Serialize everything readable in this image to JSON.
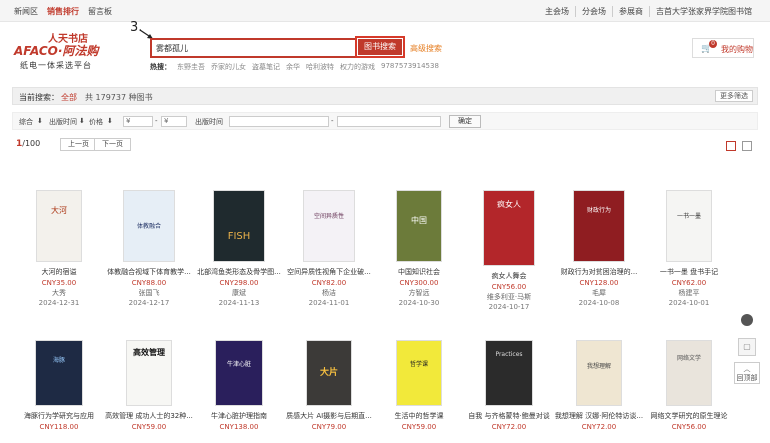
{
  "topnav": {
    "left": [
      "新闻区",
      "销售排行",
      "留言板"
    ],
    "right": [
      "主会场",
      "分会场",
      "参展商",
      "吉首大学张家界学院图书馆"
    ]
  },
  "logo": {
    "line1": "人天书店",
    "line2": "AFACO·阿法购",
    "line3": "纸电一体采选平台"
  },
  "step_marker": "3.",
  "search": {
    "value": "雾都孤儿",
    "button": "图书搜索",
    "advanced": "高级搜索"
  },
  "hot": {
    "label": "热搜：",
    "keywords": [
      "东野圭吾",
      "乔家的儿女",
      "盗墓笔记",
      "余华",
      "哈利波特",
      "权力的游戏",
      "9787573914538"
    ]
  },
  "cart": {
    "count": "0",
    "label": "我的购物"
  },
  "filter": {
    "current": "当前搜索：",
    "all": "全部",
    "total": "共 179737 种图书",
    "more": "更多筛选"
  },
  "sort": {
    "composite": "综合",
    "pubtime": "出版时间",
    "price": "价格",
    "currency": "¥",
    "dash": "-",
    "pubtime2": "出版时间",
    "confirm": "确定"
  },
  "pager": {
    "current": "1",
    "total": "/100",
    "prev": "上一页",
    "next": "下一页"
  },
  "books": [
    {
      "title": "大河的宿谥",
      "price": "CNY35.00",
      "author": "大秀",
      "date": "2024-12-31",
      "color": "#f3f1ec"
    },
    {
      "title": "体教融合视域下体育教学...",
      "price": "CNY88.00",
      "author": "张国飞",
      "date": "2024-12-17",
      "color": "#e6eef6"
    },
    {
      "title": "北部湾鱼类形态及骨学图...",
      "price": "CNY298.00",
      "author": "康斌",
      "date": "2024-11-13",
      "color": "#1f2a2e"
    },
    {
      "title": "空间异质性视角下企业破...",
      "price": "CNY82.00",
      "author": "杨洁",
      "date": "2024-11-01",
      "color": "#f4f2f6"
    },
    {
      "title": "中国知识社会",
      "price": "CNY300.00",
      "author": "方智远",
      "date": "2024-10-30",
      "color": "#6c7b3a"
    },
    {
      "title": "疯女人舞会",
      "price": "CNY56.00",
      "author": "维多利亚·马斯",
      "date": "2024-10-17",
      "color": "#b3262a"
    },
    {
      "title": "财政行为对贫困治理的...",
      "price": "CNY128.00",
      "author": "毛犀",
      "date": "2024-10-08",
      "color": "#8f1d21"
    },
    {
      "title": "一书一墨 盘书手记",
      "price": "CNY62.00",
      "author": "杨建平",
      "date": "2024-10-01",
      "color": "#f5f5f3"
    },
    {
      "title": "海豚行为学研究与应用",
      "price": "CNY118.00",
      "author": "",
      "date": "",
      "color": "#1e2a44"
    },
    {
      "title": "高效管理 成功人士的32种...",
      "price": "CNY59.00",
      "author": "",
      "date": "",
      "color": "#f7f7f4"
    },
    {
      "title": "牛津心脏护理指南",
      "price": "CNY138.00",
      "author": "",
      "date": "",
      "color": "#2a1f5c"
    },
    {
      "title": "质感大片 AI摄影与后期直...",
      "price": "CNY79.00",
      "author": "",
      "date": "",
      "color": "#3c3a38"
    },
    {
      "title": "生活中的哲学课",
      "price": "CNY59.00",
      "author": "",
      "date": "",
      "color": "#f2e93a"
    },
    {
      "title": "自我 与齐格蒙特·鲍曼对谈",
      "price": "CNY72.00",
      "author": "",
      "date": "",
      "color": "#2b2b2b"
    },
    {
      "title": "我想理解 汉娜·阿伦特访谈...",
      "price": "CNY72.00",
      "author": "",
      "date": "",
      "color": "#efe6d2"
    },
    {
      "title": "网络文学研究的原生理论",
      "price": "CNY56.00",
      "author": "",
      "date": "",
      "color": "#e9e4dc"
    }
  ],
  "side": {
    "back_top": "回顶部"
  },
  "colors": {
    "brand": "#c0392b"
  }
}
